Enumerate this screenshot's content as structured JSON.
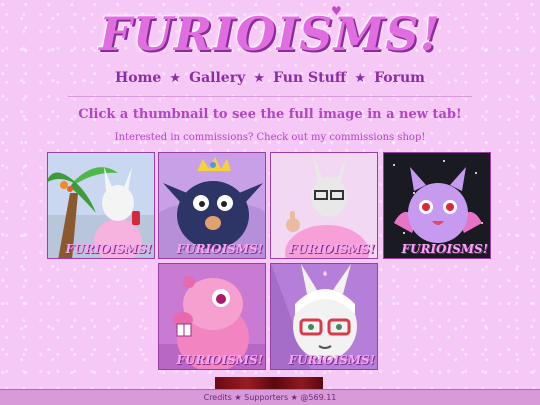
{
  "site": {
    "logo_text": "FURIOISMS!"
  },
  "nav": {
    "items": [
      "Home",
      "Gallery",
      "Fun Stuff",
      "Forum"
    ],
    "separator": "★"
  },
  "gallery": {
    "instruction": "Click a thumbnail to see the full image in a new tab!",
    "commission_prompt": "Interested in commissions? Check out my commissions shop!",
    "watermark": "FURIOISMS!",
    "thumbnails": [
      {
        "subject": "white bunny under palm tree"
      },
      {
        "subject": "navy bird with crown"
      },
      {
        "subject": "bunny with glasses thumbs up"
      },
      {
        "subject": "purple cat on starry background"
      },
      {
        "subject": "pink beaver"
      },
      {
        "subject": "bunny with red glasses"
      }
    ]
  },
  "footer": {
    "credits": "Credits",
    "supporters": "Supporters",
    "separator": "★",
    "counter": "@569.11"
  }
}
